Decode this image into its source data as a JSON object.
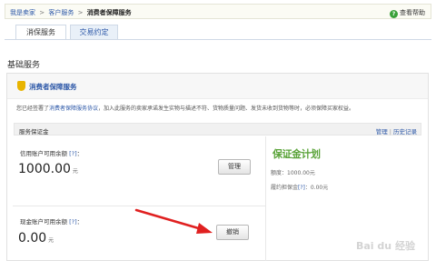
{
  "breadcrumb": {
    "items": [
      "我是卖家",
      "客户服务",
      "消费者保障服务"
    ],
    "separator": ">"
  },
  "help": {
    "label": "查看帮助",
    "icon": "help-icon"
  },
  "tabs": [
    {
      "label": "消保服务",
      "active": true
    },
    {
      "label": "交易约定",
      "active": false
    }
  ],
  "section_title": "基础服务",
  "panel": {
    "title": "消费者保障服务",
    "icon": "shield-icon",
    "notice_prefix": "您已经签署了",
    "notice_link": "消费者保障服务协议",
    "notice_suffix": "，加入此服务的卖家承诺发生实物与描述不符、货物质量问题、发货未收到货物等时，必须保障买家权益。"
  },
  "deposit": {
    "label": "服务保证金",
    "manage_link": "管理",
    "separator": "|",
    "history_link": "历史记录"
  },
  "credit_account": {
    "label": "信用账户可用余额",
    "help": "[?]",
    "colon": "：",
    "amount": "1000.00",
    "unit": "元",
    "button": "管理"
  },
  "cash_account": {
    "label": "现金账户可用余额",
    "help": "[?]",
    "colon": "：",
    "amount": "0.00",
    "unit": "元",
    "button": "撤销"
  },
  "plan": {
    "logo_text": "保证金计划",
    "quota_label": "额度：",
    "quota_value": "1000.00元",
    "fee_label": "履约担保金",
    "fee_help": "[?]",
    "fee_value": "：0.00元"
  },
  "colors": {
    "link": "#2d58a8",
    "accent_green": "#5aa339",
    "arrow_red": "#e02020"
  }
}
